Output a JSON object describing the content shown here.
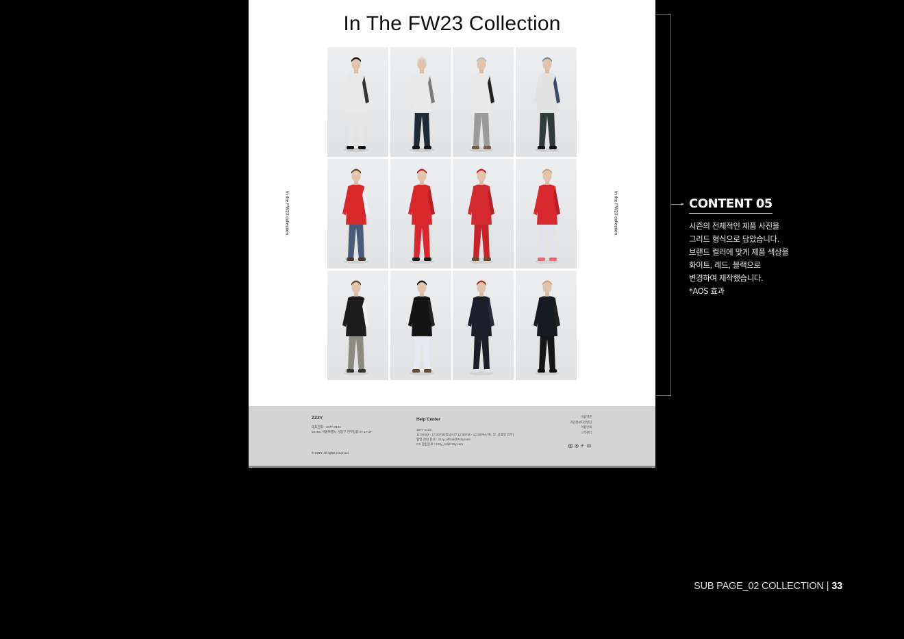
{
  "mockup": {
    "title": "In The FW23 Collection",
    "side_text_left": "In the FW23 collection.",
    "side_text_right": "In the FW23 collection.",
    "grid": [
      {
        "top": "#e8e8e8",
        "bottom": "#e6e6e6",
        "accent": "#333333",
        "hat": "#111111",
        "shoes": "#111111"
      },
      {
        "top": "#e9e9e9",
        "bottom": "#1e2a36",
        "accent": "#7a7a7a",
        "hat": "#d9d9d9",
        "shoes": "#111111"
      },
      {
        "top": "#e9e9e9",
        "bottom": "#9a9a9a",
        "accent": "#222222",
        "hat": "#bbbbbb",
        "shoes": "#7a5a3a"
      },
      {
        "top": "#e2e2e2",
        "bottom": "#2f3b38",
        "accent": "#3c4a6b",
        "hat": "#7f8fa0",
        "shoes": "#111111"
      },
      {
        "top": "#d7282c",
        "bottom": "#4a5a7a",
        "accent": "#f2f2f2",
        "hat": "#6b4a2b",
        "shoes": "#4a3a30"
      },
      {
        "top": "#d7282c",
        "bottom": "#d9272d",
        "accent": "#b81e24",
        "hat": "#c81f25",
        "shoes": "#1a1a1a"
      },
      {
        "top": "#d32a2f",
        "bottom": "#c62228",
        "accent": "#b81e24",
        "hat": "#c81f25",
        "shoes": "#6a4a30"
      },
      {
        "top": "#d7282c",
        "bottom": "#e3e2ec",
        "accent": "#b81e24",
        "hat": "#c9a273",
        "shoes": "#e06b7a"
      },
      {
        "top": "#1c1c1c",
        "bottom": "#8c8a80",
        "accent": "#f0f0f0",
        "hat": "#6b4a2b",
        "shoes": "#333333"
      },
      {
        "top": "#141414",
        "bottom": "#e8e8f2",
        "accent": "#222222",
        "hat": "#1a1a1a",
        "shoes": "#6a4a30"
      },
      {
        "top": "#1a1f2a",
        "bottom": "#1a1e26",
        "accent": "#262c38",
        "hat": "#b22a2a",
        "shoes": "#e0e0e0"
      },
      {
        "top": "#161a22",
        "bottom": "#161616",
        "accent": "#222222",
        "hat": "#c9a273",
        "shoes": "#111111"
      }
    ],
    "footer": {
      "brand": "ZZZY",
      "phone_line": "대표전화 : 1877-0123",
      "address_line": "04783, 서울특별시 성동구 연무장길 87 1F-2F",
      "copyright": "© ZZZY All rights reserved.",
      "help_title": "Help Center",
      "help_lines": [
        "1877-0123",
        "11:00AM - 17:00PM(점심시간 12:30PM - 13:30PM / 토, 일, 공휴일 휴무)",
        "협업 관련 문의 : zzzy_offical@zzzy.com",
        "CS 관련문의 : zzzy_cs@zzzy.com"
      ],
      "links": [
        "이용약관",
        "개인정보처리방침",
        "이용안내",
        "고객센터"
      ],
      "icons": [
        "instagram-icon",
        "chat-icon",
        "facebook-icon",
        "youtube-icon"
      ]
    }
  },
  "annotation": {
    "title": "CONTENT 05",
    "lines": [
      "시즌의 전체적인 제품 사진을",
      "그리드 형식으로 담았습니다.",
      "브랜드 컬러에 맞게 제품 색상을",
      "화이트, 레드, 블랙으로",
      "변경하여 제작했습니다.",
      "*AOS 효과"
    ]
  },
  "page_label": {
    "text": "SUB PAGE_02 COLLECTION",
    "separator": "|",
    "number": "33"
  }
}
